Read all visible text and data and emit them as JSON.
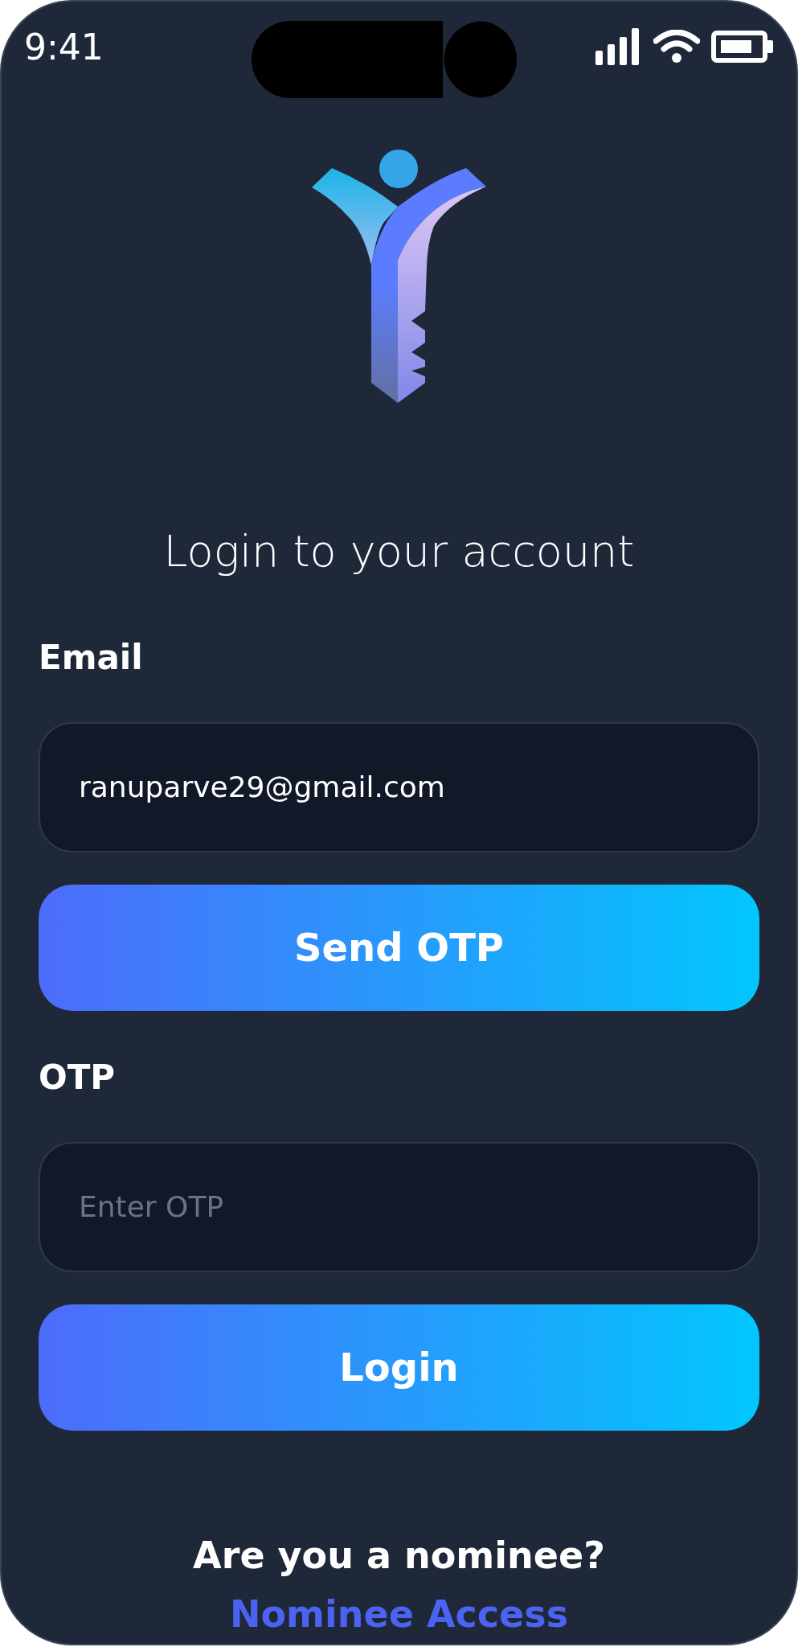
{
  "status_bar": {
    "time": "9:41"
  },
  "title": "Login to your account",
  "email": {
    "label": "Email",
    "value": "ranuparve29@gmail.com"
  },
  "send_otp_button": "Send OTP",
  "otp": {
    "label": "OTP",
    "placeholder": "Enter OTP"
  },
  "login_button": "Login",
  "nominee_prompt": "Are you a nominee?",
  "nominee_link": "Nominee Access"
}
